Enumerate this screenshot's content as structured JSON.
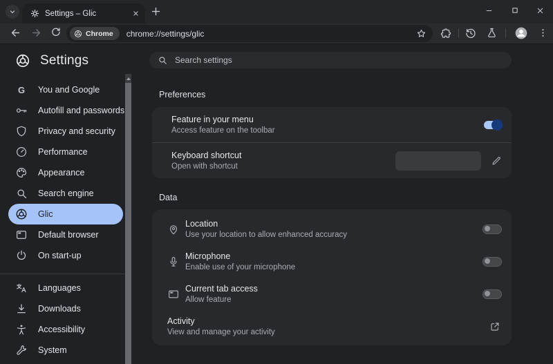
{
  "colors": {
    "accent_blue": "#A8C7FA",
    "selected_pill": "#A5C3F7",
    "toggle_on_thumb": "#163B7C",
    "card_bg": "#28292D",
    "page_bg": "#202124"
  },
  "tabstrip": {
    "tab_title": "Settings – Glic"
  },
  "toolbar": {
    "chip_label": "Chrome",
    "url": "chrome://settings/glic"
  },
  "sidebar": {
    "title": "Settings",
    "items": [
      {
        "label": "You and Google",
        "icon": "google-g"
      },
      {
        "label": "Autofill and passwords",
        "icon": "key"
      },
      {
        "label": "Privacy and security",
        "icon": "shield"
      },
      {
        "label": "Performance",
        "icon": "speedometer"
      },
      {
        "label": "Appearance",
        "icon": "palette"
      },
      {
        "label": "Search engine",
        "icon": "magnifier"
      },
      {
        "label": "Glic",
        "icon": "glic-logo",
        "selected": true
      },
      {
        "label": "Default browser",
        "icon": "browser-window"
      },
      {
        "label": "On start-up",
        "icon": "power"
      },
      {
        "label": "Languages",
        "icon": "translate"
      },
      {
        "label": "Downloads",
        "icon": "download"
      },
      {
        "label": "Accessibility",
        "icon": "accessibility"
      },
      {
        "label": "System",
        "icon": "wrench"
      }
    ]
  },
  "search": {
    "placeholder": "Search settings"
  },
  "preferences": {
    "title": "Preferences",
    "rows": [
      {
        "label": "Feature in your menu",
        "sublabel": "Access feature on the toolbar",
        "toggle": "on"
      },
      {
        "label": "Keyboard shortcut",
        "sublabel": "Open with shortcut",
        "input_value": ""
      }
    ]
  },
  "data_section": {
    "title": "Data",
    "rows": [
      {
        "icon": "location-pin",
        "label": "Location",
        "sublabel": "Use your location to allow enhanced accuracy",
        "toggle": "off"
      },
      {
        "icon": "microphone",
        "label": "Microphone",
        "sublabel": "Enable use of your microphone",
        "toggle": "off"
      },
      {
        "icon": "browser-tab",
        "label": "Current tab access",
        "sublabel": "Allow feature",
        "toggle": "off"
      },
      {
        "label": "Activity",
        "sublabel": "View and manage your activity",
        "action": "open-external"
      }
    ]
  }
}
